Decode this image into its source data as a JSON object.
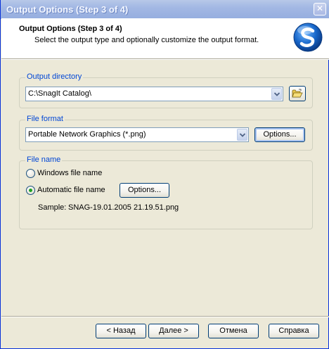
{
  "window": {
    "title": "Output Options (Step 3 of 4)",
    "close_glyph": "✕"
  },
  "header": {
    "title": "Output Options (Step 3 of 4)",
    "subtitle": "Select the output type and optionally customize the output format.",
    "logo_icon": "snagit-logo-icon"
  },
  "output_directory": {
    "label": "Output directory",
    "value": "C:\\SnagIt Catalog\\",
    "browse_icon": "folder-open-icon"
  },
  "file_format": {
    "label": "File format",
    "value": "Portable Network Graphics (*.png)",
    "options_button": "Options..."
  },
  "file_name": {
    "label": "File name",
    "windows_option": "Windows file name",
    "automatic_option": "Automatic file name",
    "selected": "automatic",
    "options_button": "Options...",
    "sample_label": "Sample:",
    "sample_value": "SNAG-19.01.2005 21.19.51.png"
  },
  "footer": {
    "back": "< Назад",
    "next": "Далее >",
    "cancel": "Отмена",
    "help": "Справка"
  },
  "colors": {
    "group_label": "#0046d5",
    "radio_dot": "#21a121",
    "button_border": "#003c74"
  }
}
